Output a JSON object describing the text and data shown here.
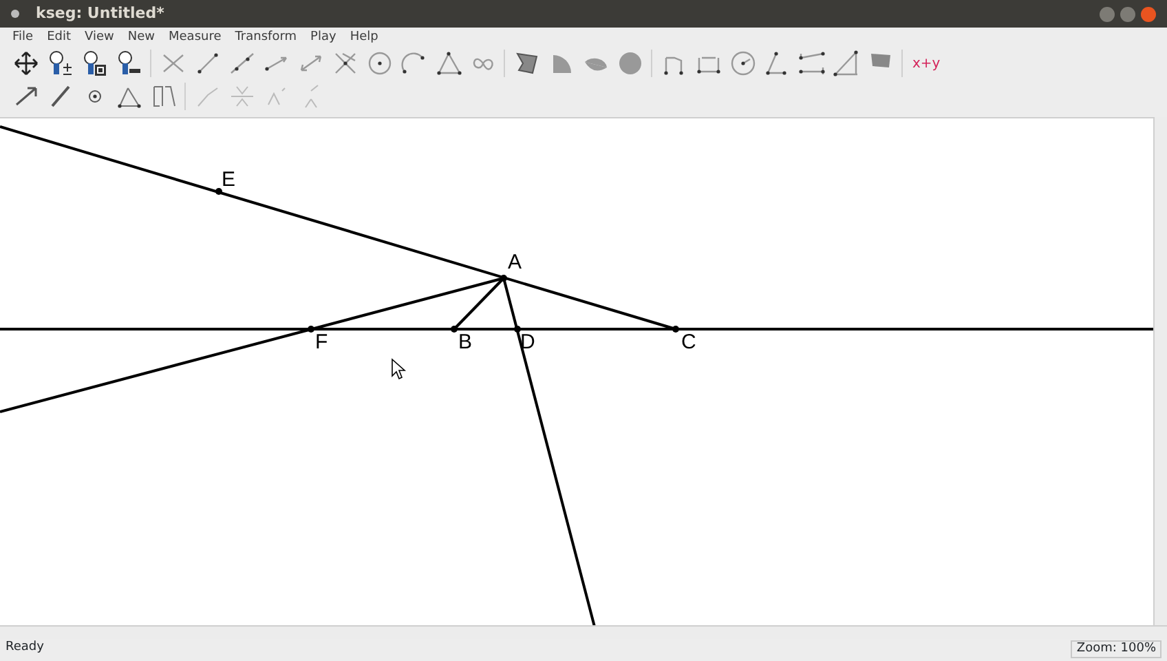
{
  "window": {
    "title": "kseg: Untitled*"
  },
  "menu": [
    {
      "label": "File"
    },
    {
      "label": "Edit"
    },
    {
      "label": "View"
    },
    {
      "label": "New"
    },
    {
      "label": "Measure"
    },
    {
      "label": "Transform"
    },
    {
      "label": "Play"
    },
    {
      "label": "Help"
    }
  ],
  "toolbar": {
    "calculator_button": "x+y"
  },
  "canvas": {
    "points": [
      {
        "label": "E"
      },
      {
        "label": "A"
      },
      {
        "label": "F"
      },
      {
        "label": "B"
      },
      {
        "label": "D"
      },
      {
        "label": "C"
      }
    ]
  },
  "status_bar": {
    "message": "Ready",
    "zoom": "Zoom: 100%"
  }
}
